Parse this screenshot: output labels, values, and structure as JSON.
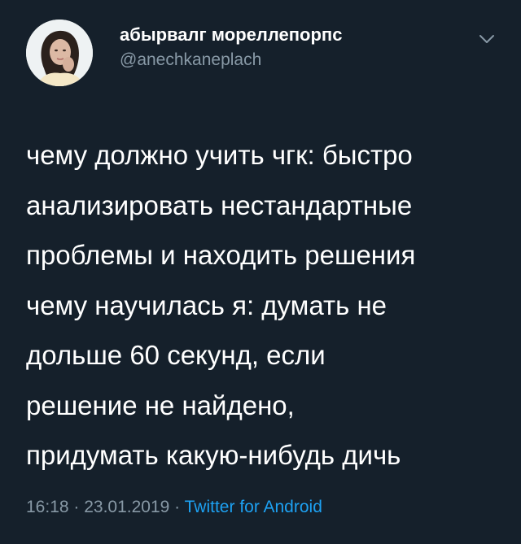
{
  "author": {
    "display_name": "абырвалг мореллепорпс",
    "handle": "@anechkaneplach",
    "avatar_icon": "profile-photo"
  },
  "menu_icon": "chevron-down-icon",
  "tweet": {
    "lines": [
      "чему должно учить чгк: быстро",
      "анализировать нестандартные",
      "проблемы и находить решения",
      "чему научилась я: думать не",
      "дольше 60 секунд, если",
      "решение не найдено,",
      "придумать какую-нибудь дичь"
    ]
  },
  "meta": {
    "time": "16:18",
    "separator_1": " · ",
    "date": "23.01.2019",
    "separator_2": " · ",
    "source": "Twitter for Android"
  },
  "colors": {
    "background": "#15202b",
    "text": "#ffffff",
    "secondary_text": "#8899a6",
    "accent": "#1da1f2"
  }
}
